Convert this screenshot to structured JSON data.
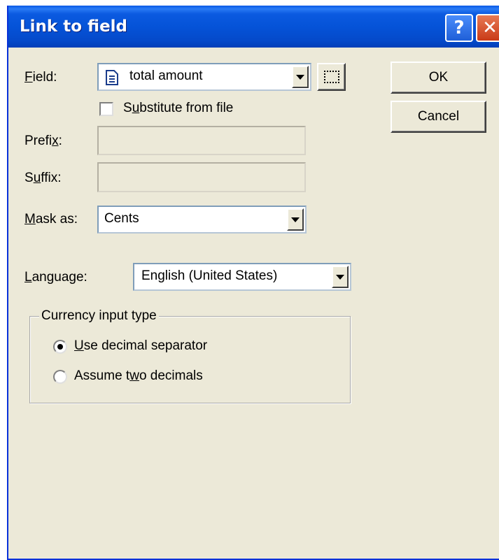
{
  "window": {
    "title": "Link to field",
    "help_glyph": "?",
    "close_glyph": "✕"
  },
  "field": {
    "label_hotkey": "F",
    "label_rest": "ield:",
    "value": "total amount",
    "icon": "document-icon",
    "browse_icon": "dotted-box-icon"
  },
  "substitute": {
    "checked": false,
    "pre": "S",
    "hotkey": "u",
    "post": "bstitute from file"
  },
  "prefix": {
    "pre": "Prefi",
    "hotkey": "x",
    "post": ":",
    "value": ""
  },
  "suffix": {
    "pre": "S",
    "hotkey": "u",
    "post": "ffix:",
    "value": ""
  },
  "mask": {
    "hotkey": "M",
    "post": "ask as:",
    "value": "Cents"
  },
  "language": {
    "hotkey": "L",
    "post": "anguage:",
    "value": "English (United States)"
  },
  "currency": {
    "group_title": "Currency input type",
    "options": [
      {
        "hotkey": "U",
        "post": "se decimal separator",
        "selected": true
      },
      {
        "pre": "Assume t",
        "hotkey": "w",
        "post": "o decimals",
        "selected": false
      }
    ]
  },
  "buttons": {
    "ok": "OK",
    "cancel": "Cancel"
  },
  "colors": {
    "title_bar": "#0553d8",
    "dialog_face": "#ece9d8",
    "close_button": "#c93a17"
  }
}
